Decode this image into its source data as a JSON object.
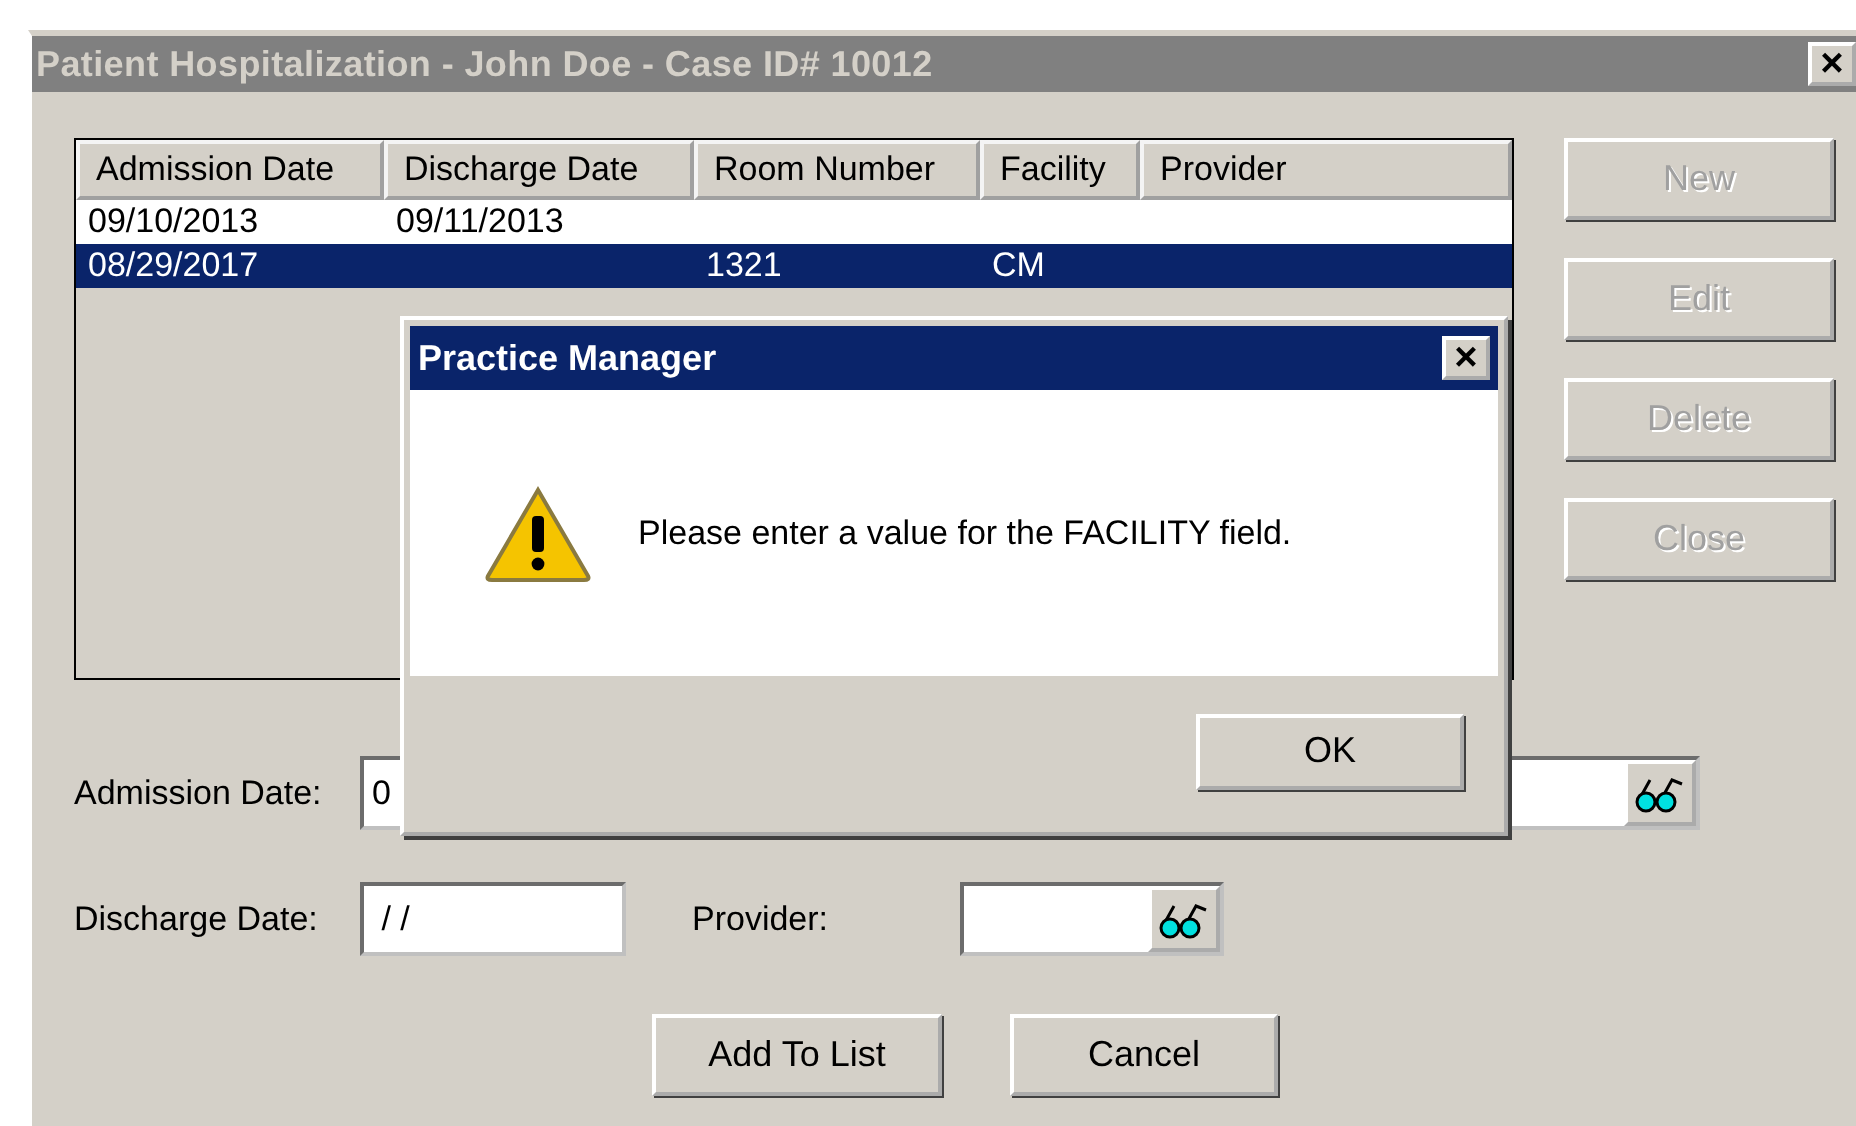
{
  "window": {
    "title": "Patient Hospitalization - John Doe - Case ID# 10012",
    "close": "×"
  },
  "table": {
    "columns": [
      "Admission Date",
      "Discharge Date",
      "Room Number",
      "Facility",
      "Provider"
    ],
    "rows": [
      {
        "cells": [
          "09/10/2013",
          "09/11/2013",
          "",
          "",
          ""
        ],
        "selected": false
      },
      {
        "cells": [
          "08/29/2017",
          "",
          "1321",
          "CM",
          ""
        ],
        "selected": true
      }
    ]
  },
  "side_buttons": [
    {
      "label": "New",
      "disabled": true
    },
    {
      "label": "Edit",
      "disabled": true
    },
    {
      "label": "Delete",
      "disabled": true
    },
    {
      "label": "Close",
      "disabled": true
    }
  ],
  "form": {
    "admission_label": "Admission Date:",
    "admission_value": "0",
    "discharge_label": "Discharge Date:",
    "discharge_value": " / /",
    "provider_label": "Provider:"
  },
  "actions": [
    "Add To List",
    "Cancel"
  ],
  "dialog": {
    "title": "Practice Manager",
    "close": "×",
    "message": "Please enter a value for the FACILITY field.",
    "button": "OK"
  }
}
